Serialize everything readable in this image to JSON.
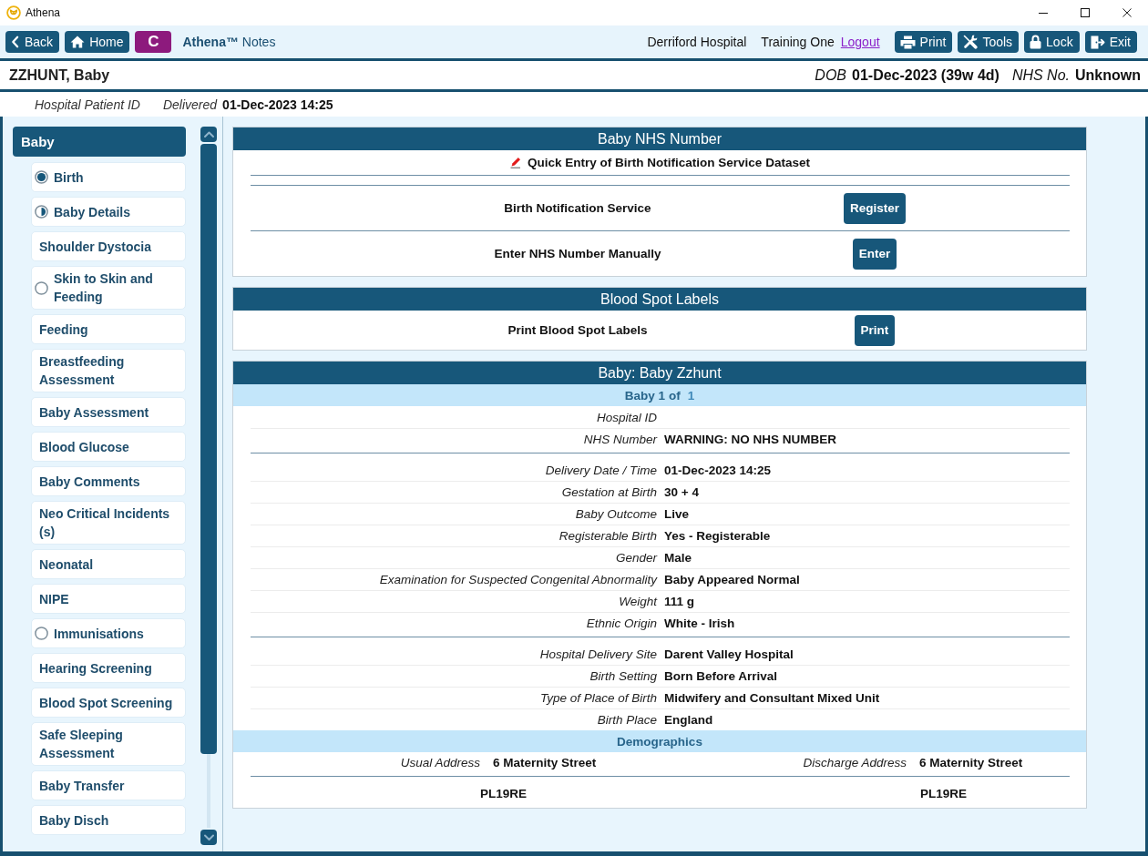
{
  "window": {
    "title": "Athena"
  },
  "toolbar": {
    "nav_buttons": [
      {
        "kind": "back",
        "label": "Back"
      },
      {
        "kind": "home",
        "label": "Home"
      },
      {
        "kind": "context",
        "label": "C"
      }
    ],
    "app_title": "**Athena™** Notes",
    "hospital": "Derriford Hospital",
    "user": "Training One",
    "logout": "Logout",
    "action_buttons": [
      {
        "kind": "print",
        "label": "Print"
      },
      {
        "kind": "tools",
        "label": "Tools"
      },
      {
        "kind": "lock",
        "label": "Lock"
      },
      {
        "kind": "exit",
        "label": "Exit"
      }
    ]
  },
  "patient": {
    "name": "ZZHUNT, Baby",
    "fields": [
      {
        "label": "DOB",
        "value": "01-Dec-2023 (39w 4d)"
      },
      {
        "label": "NHS No.",
        "value": "Unknown"
      }
    ],
    "details": [
      {
        "label": "Hospital Patient ID"
      },
      {
        "label": "Delivered",
        "value": "01-Dec-2023 14:25"
      }
    ]
  },
  "sidebar": {
    "group": "Baby",
    "items": [
      {
        "label": "Birth",
        "complete": true
      },
      {
        "label": "Baby Details",
        "complete": false,
        "started": true
      },
      {
        "label": "Shoulder Dystocia"
      },
      {
        "label": "Skin to Skin and Feeding",
        "complete": false,
        "started": false
      },
      {
        "label": "Feeding"
      },
      {
        "label": "Breastfeeding Assessment"
      },
      {
        "label": "Baby Assessment"
      },
      {
        "label": "Blood Glucose"
      },
      {
        "label": "Baby Comments"
      },
      {
        "label": "Neo Critical Incidents (s)"
      },
      {
        "label": "Neonatal"
      },
      {
        "label": "NIPE"
      },
      {
        "label": "Immunisations",
        "complete": false,
        "started": false
      },
      {
        "label": "Hearing Screening"
      },
      {
        "label": "Blood Spot Screening"
      },
      {
        "label": "Safe Sleeping Assessment"
      },
      {
        "label": "Baby Transfer"
      },
      {
        "label": "Baby Disch"
      }
    ]
  },
  "nhs_panel": {
    "title": "Baby NHS Number",
    "quick_entry": "Quick Entry of Birth Notification Service Dataset",
    "actions": [
      {
        "label": "Birth Notification Service",
        "button": "Register"
      },
      {
        "label": "Enter NHS Number Manually",
        "button": "Enter"
      }
    ]
  },
  "blood_spot_panel": {
    "title": "Blood Spot Labels",
    "actions": [
      {
        "label": "Print Blood Spot Labels",
        "button": "Print"
      }
    ]
  },
  "baby_panel": {
    "title": "Baby: Baby Zzhunt",
    "pager": {
      "text": "Baby 1 of",
      "count": "1"
    },
    "field_groups": [
      {
        "fields": [
          {
            "label": "Hospital ID"
          },
          {
            "label": "NHS Number",
            "value": "WARNING: NO NHS NUMBER"
          }
        ]
      },
      {
        "fields": [
          {
            "label": "Delivery Date / Time",
            "value": "01-Dec-2023 14:25"
          },
          {
            "label": "Gestation at Birth",
            "value": "30 + 4"
          },
          {
            "label": "Baby Outcome",
            "value": "Live"
          },
          {
            "label": "Registerable Birth",
            "value": "Yes - Registerable"
          },
          {
            "label": "Gender",
            "value": "Male"
          },
          {
            "label": "Examination for Suspected Congenital Abnormality",
            "value": "Baby Appeared Normal"
          },
          {
            "label": "Weight",
            "value": "111 g"
          },
          {
            "label": "Ethnic Origin",
            "value": "White - Irish"
          }
        ]
      },
      {
        "fields": [
          {
            "label": "Hospital Delivery Site",
            "value": "Darent Valley Hospital"
          },
          {
            "label": "Birth Setting",
            "value": "Born Before Arrival"
          },
          {
            "label": "Type of Place of Birth",
            "value": "Midwifery and Consultant Mixed Unit"
          },
          {
            "label": "Birth Place",
            "value": "England"
          }
        ]
      }
    ],
    "demographics": {
      "title": "Demographics",
      "addresses": [
        {
          "label": "Usual Address",
          "line1": "6 Maternity Street",
          "postcode": "PL19RE"
        },
        {
          "label": "Discharge Address",
          "line1": "6 Maternity Street",
          "postcode": "PL19RE"
        }
      ]
    }
  }
}
